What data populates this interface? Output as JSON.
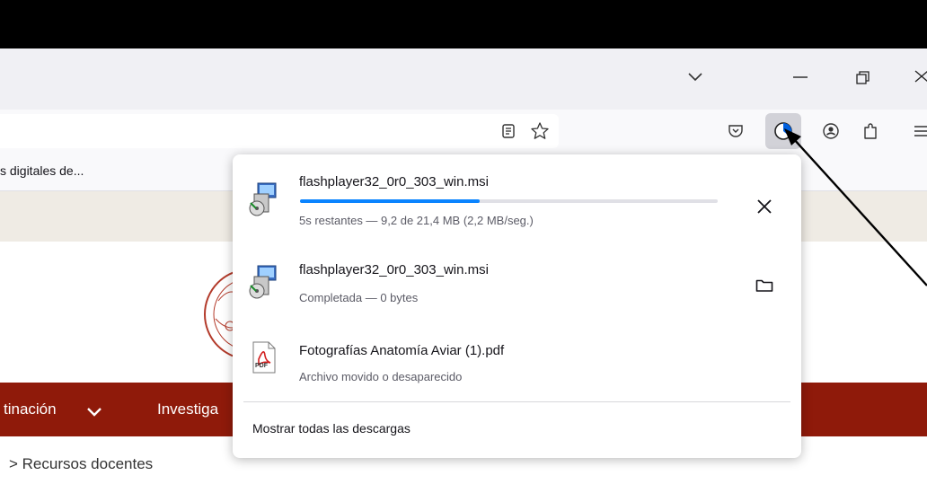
{
  "bookmarks": {
    "item_text": "s digitales de..."
  },
  "page": {
    "nav_item_1": "tinación",
    "nav_item_2": "Investiga",
    "breadcrumb": "> Recursos docentes"
  },
  "downloads_panel": {
    "items": [
      {
        "filename": "flashplayer32_0r0_303_win.msi",
        "status": "5s restantes — 9,2 de 21,4 MB (2,2 MB/seg.)",
        "progress": 0.43,
        "icon": "msi-installer-icon",
        "action": "cancel"
      },
      {
        "filename": "flashplayer32_0r0_303_win.msi",
        "status": "Completada — 0 bytes",
        "icon": "msi-installer-icon",
        "action": "show-in-folder"
      },
      {
        "filename": "Fotografías Anatomía Aviar (1).pdf",
        "status": "Archivo movido o desaparecido",
        "icon": "pdf-icon",
        "icon_label": "PDF"
      }
    ],
    "show_all_label": "Mostrar todas las descargas"
  },
  "colors": {
    "progress": "#0a84ff",
    "progress_track": "#e0e0e6",
    "nav_red": "#8f1a0a",
    "download_icon_blue": "#0060df"
  }
}
